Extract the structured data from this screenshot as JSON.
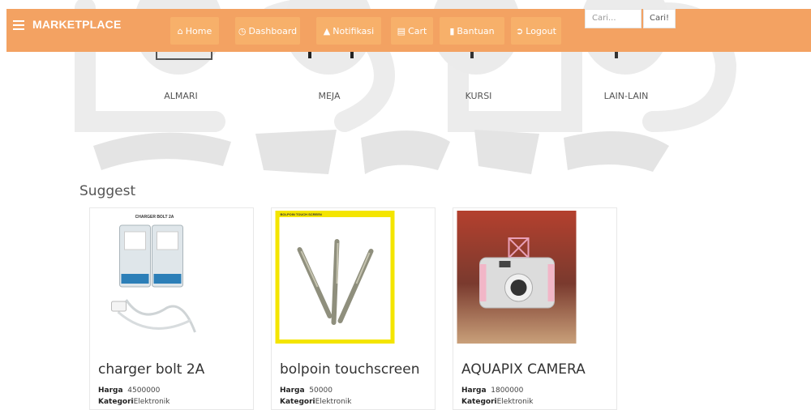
{
  "navbar": {
    "brand": "MARKETPLACE",
    "items": [
      {
        "label": "Home",
        "icon": "home-icon"
      },
      {
        "label": "Dashboard",
        "icon": "dashboard-icon"
      },
      {
        "label": "Notifikasi",
        "icon": "bell-icon"
      },
      {
        "label": "Cart",
        "icon": "cart-icon"
      },
      {
        "label": "Bantuan",
        "icon": "book-icon"
      },
      {
        "label": "Logout",
        "icon": "logout-icon"
      }
    ],
    "search_placeholder": "Cari...",
    "search_button": "Cari!"
  },
  "categories": [
    "ALMARI",
    "MEJA",
    "KURSI",
    "LAIN-LAIN"
  ],
  "suggest_title": "Suggest",
  "products": [
    {
      "name": "charger bolt 2A",
      "price_label": "Harga",
      "price": "4500000",
      "category_label": "Kategori",
      "category": "Elektronik",
      "image_caption": "CHARGER BOLT 2A"
    },
    {
      "name": "bolpoin touchscreen",
      "price_label": "Harga",
      "price": "50000",
      "category_label": "Kategori",
      "category": "Elektronik",
      "image_caption": "BOLPOIN TOUCH SCREEN"
    },
    {
      "name": "AQUAPIX CAMERA",
      "price_label": "Harga",
      "price": "1800000",
      "category_label": "Kategori",
      "category": "Elektronik",
      "image_caption": ""
    }
  ],
  "colors": {
    "navbar": "#f3a262",
    "nav_button": "#f7b06a",
    "accent_yellow": "#f4e500"
  }
}
